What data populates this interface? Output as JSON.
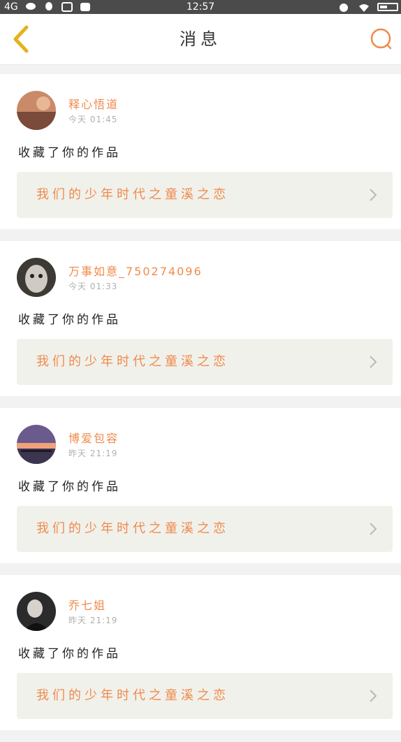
{
  "status_bar": {
    "network": "4G",
    "time": "12:57"
  },
  "header": {
    "title": "消息"
  },
  "colors": {
    "accent": "#f08a4b",
    "back_icon": "#e6b21c",
    "card_link_bg": "#f1f1eb"
  },
  "icons": {
    "back": "chevron-left-icon",
    "search": "search-icon",
    "link": "chevron-right-icon"
  },
  "notifications": [
    {
      "username": "释心悟道",
      "time": "今天 01:45",
      "action": "收藏了你的作品",
      "work_title": "我们的少年时代之童溪之恋"
    },
    {
      "username": "万事如意_750274096",
      "time": "今天 01:33",
      "action": "收藏了你的作品",
      "work_title": "我们的少年时代之童溪之恋"
    },
    {
      "username": "博爱包容",
      "time": "昨天 21:19",
      "action": "收藏了你的作品",
      "work_title": "我们的少年时代之童溪之恋"
    },
    {
      "username": "乔七姐",
      "time": "昨天 21:19",
      "action": "收藏了你的作品",
      "work_title": "我们的少年时代之童溪之恋"
    }
  ]
}
